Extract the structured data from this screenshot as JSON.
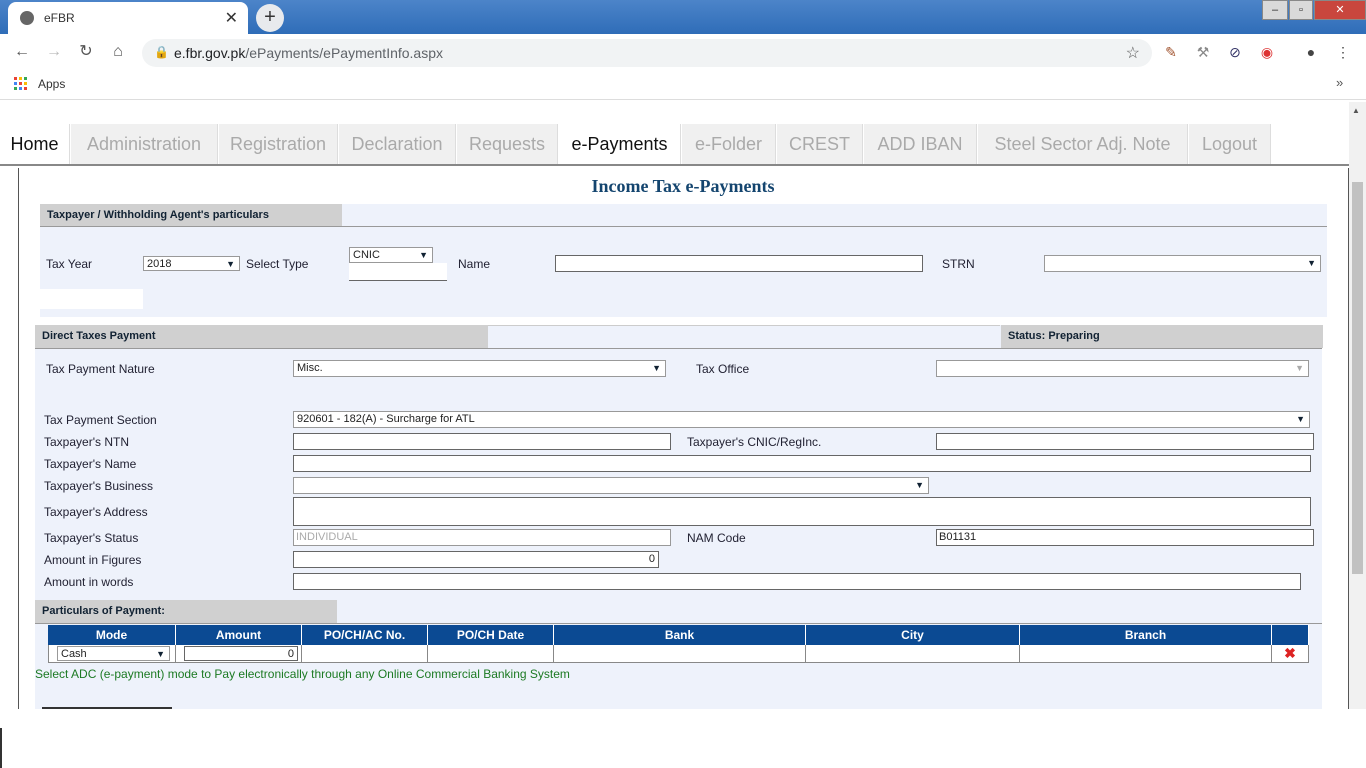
{
  "browser": {
    "tab_title": "eFBR",
    "url_host": "e.fbr.gov.pk",
    "url_path": "/ePayments/ePaymentInfo.aspx",
    "bookmarks_apps": "Apps",
    "new_tab": "+",
    "close": "✕"
  },
  "menu": [
    {
      "label": "Home"
    },
    {
      "label": "Administration"
    },
    {
      "label": "Registration"
    },
    {
      "label": "Declaration"
    },
    {
      "label": "Requests"
    },
    {
      "label": "e-Payments"
    },
    {
      "label": "e-Folder"
    },
    {
      "label": "CREST"
    },
    {
      "label": "ADD IBAN"
    },
    {
      "label": "Steel Sector Adj. Note"
    },
    {
      "label": "Logout"
    }
  ],
  "page_title": "Income Tax e-Payments",
  "taxpayer": {
    "section_title": "Taxpayer / Withholding Agent's particulars",
    "tax_year_label": "Tax Year",
    "tax_year_value": "2018",
    "select_type_label": "Select Type",
    "select_type_value": "CNIC",
    "name_label": "Name",
    "name_value": "",
    "strn_label": "STRN",
    "strn_value": ""
  },
  "direct": {
    "section_title": "Direct Taxes Payment",
    "status": "Status: Preparing",
    "nature_label": "Tax Payment Nature",
    "nature_value": "Misc.",
    "office_label": "Tax Office",
    "office_value": "",
    "section_label": "Tax Payment Section",
    "section_value": "920601 - 182(A) - Surcharge for ATL",
    "ntn_label": "Taxpayer's NTN",
    "cnic_label": "Taxpayer's CNIC/RegInc.",
    "tname_label": "Taxpayer's Name",
    "business_label": "Taxpayer's Business",
    "address_label": "Taxpayer's Address",
    "status_label": "Taxpayer's Status",
    "status_value": "INDIVIDUAL",
    "nam_label": "NAM Code",
    "nam_value": "B01131",
    "amount_label": "Amount in Figures",
    "amount_value": "0",
    "words_label": "Amount in words"
  },
  "payment": {
    "section_title": "Particulars of Payment:",
    "headers": [
      "Mode",
      "Amount",
      "PO/CH/AC No.",
      "PO/CH Date",
      "Bank",
      "City",
      "Branch"
    ],
    "mode_value": "Cash",
    "amount_value": "0",
    "note": "Select ADC (e-payment) mode to Pay electronically through any Online Commercial Banking System"
  },
  "colors": {
    "header_blue": "#0b4a93",
    "title_blue": "#14456f",
    "note_green": "#1c7a23"
  }
}
